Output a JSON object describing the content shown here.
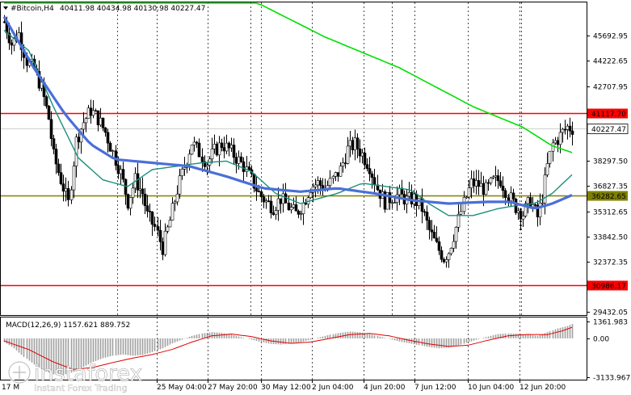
{
  "header": {
    "symbol_label": "#Bitcoin,H4",
    "ohlc": "40411.98 40434.98 40130.98 40227.47"
  },
  "chart_data": [
    {
      "type": "candlestick",
      "symbol": "#Bitcoin",
      "timeframe": "H4",
      "ylim": [
        29432.05,
        47162.61
      ],
      "y_ticks": [
        "45692.95",
        "44222.65",
        "42707.95",
        "38297.50",
        "36827.35",
        "35312.65",
        "33842.50",
        "32372.35",
        "29432.05"
      ],
      "x_ticks": [
        "17 M",
        "25 May 04:00",
        "27 May 20:00",
        "30 May 12:00",
        "2 Jun 04:00",
        "4 Jun 20:00",
        "7 Jun 12:00",
        "10 Jun 04:00",
        "12 Jun 20:00"
      ],
      "last_price": "40227.47",
      "levels": [
        {
          "value": 41117.7,
          "label": "41117.70",
          "color": "#ff0000"
        },
        {
          "value": 36282.65,
          "label": "36282.65",
          "color": "#808000"
        },
        {
          "value": 30986.17,
          "label": "30986.17",
          "color": "#ff0000"
        }
      ],
      "price_path": [
        [
          0,
          46500
        ],
        [
          3,
          45200
        ],
        [
          6,
          45800
        ],
        [
          9,
          44200
        ],
        [
          12,
          43700
        ],
        [
          15,
          42600
        ],
        [
          18,
          40800
        ],
        [
          20,
          38600
        ],
        [
          23,
          37200
        ],
        [
          26,
          35800
        ],
        [
          29,
          39500
        ],
        [
          32,
          40600
        ],
        [
          35,
          41300
        ],
        [
          38,
          40800
        ],
        [
          41,
          40000
        ],
        [
          44,
          38800
        ],
        [
          47,
          37600
        ],
        [
          50,
          35900
        ],
        [
          53,
          37200
        ],
        [
          56,
          36400
        ],
        [
          58,
          35100
        ],
        [
          61,
          34400
        ],
        [
          64,
          33200
        ],
        [
          67,
          34800
        ],
        [
          70,
          36600
        ],
        [
          73,
          38000
        ],
        [
          76,
          39400
        ],
        [
          79,
          38800
        ],
        [
          82,
          38200
        ],
        [
          85,
          38900
        ],
        [
          88,
          39300
        ],
        [
          91,
          39000
        ],
        [
          94,
          38500
        ],
        [
          97,
          38000
        ],
        [
          100,
          37200
        ],
        [
          103,
          36400
        ],
        [
          106,
          35900
        ],
        [
          109,
          35600
        ],
        [
          112,
          36100
        ],
        [
          115,
          35600
        ],
        [
          118,
          35200
        ],
        [
          121,
          35800
        ],
        [
          124,
          36800
        ],
        [
          127,
          37000
        ],
        [
          130,
          36700
        ],
        [
          133,
          37200
        ],
        [
          136,
          37800
        ],
        [
          139,
          39000
        ],
        [
          142,
          39300
        ],
        [
          145,
          38700
        ],
        [
          148,
          38000
        ],
        [
          151,
          36700
        ],
        [
          154,
          35900
        ],
        [
          157,
          36200
        ],
        [
          160,
          36300
        ],
        [
          163,
          36000
        ],
        [
          166,
          36100
        ],
        [
          169,
          35500
        ],
        [
          172,
          34200
        ],
        [
          175,
          33300
        ],
        [
          178,
          32600
        ],
        [
          180,
          33000
        ],
        [
          183,
          34400
        ],
        [
          186,
          35800
        ],
        [
          189,
          37000
        ],
        [
          192,
          36900
        ],
        [
          195,
          36600
        ],
        [
          198,
          37100
        ],
        [
          201,
          37200
        ],
        [
          204,
          36300
        ],
        [
          207,
          35600
        ],
        [
          210,
          35200
        ],
        [
          213,
          36000
        ],
        [
          216,
          35000
        ],
        [
          218,
          36200
        ],
        [
          220,
          38000
        ],
        [
          222,
          39300
        ],
        [
          224,
          39600
        ],
        [
          226,
          40000
        ],
        [
          228,
          40300
        ],
        [
          230,
          40227
        ]
      ],
      "ma_slow": [
        [
          0,
          52000
        ],
        [
          60,
          50000
        ],
        [
          100,
          47800
        ],
        [
          130,
          45600
        ],
        [
          160,
          43800
        ],
        [
          190,
          41500
        ],
        [
          210,
          40300
        ],
        [
          222,
          39200
        ],
        [
          230,
          38800
        ]
      ],
      "ma_mid": [
        [
          0,
          46800
        ],
        [
          12,
          43800
        ],
        [
          25,
          41000
        ],
        [
          35,
          39300
        ],
        [
          45,
          38400
        ],
        [
          60,
          38200
        ],
        [
          75,
          38000
        ],
        [
          90,
          37400
        ],
        [
          105,
          36700
        ],
        [
          120,
          36500
        ],
        [
          135,
          36700
        ],
        [
          150,
          36400
        ],
        [
          165,
          36000
        ],
        [
          180,
          35800
        ],
        [
          195,
          35900
        ],
        [
          205,
          35900
        ],
        [
          215,
          35500
        ],
        [
          222,
          35800
        ],
        [
          230,
          36300
        ]
      ],
      "ma_fast": [
        [
          0,
          46000
        ],
        [
          10,
          44800
        ],
        [
          20,
          41500
        ],
        [
          30,
          38500
        ],
        [
          40,
          37200
        ],
        [
          50,
          36800
        ],
        [
          60,
          37800
        ],
        [
          70,
          38000
        ],
        [
          80,
          38200
        ],
        [
          90,
          38300
        ],
        [
          100,
          37700
        ],
        [
          110,
          36400
        ],
        [
          120,
          35800
        ],
        [
          135,
          36400
        ],
        [
          145,
          37000
        ],
        [
          155,
          36800
        ],
        [
          165,
          36600
        ],
        [
          172,
          35800
        ],
        [
          180,
          35100
        ],
        [
          190,
          35100
        ],
        [
          200,
          35500
        ],
        [
          208,
          35700
        ],
        [
          215,
          35800
        ],
        [
          222,
          36400
        ],
        [
          230,
          37500
        ]
      ]
    },
    {
      "type": "bar",
      "indicator": "MACD",
      "params_label": "MACD(12,26,9) 1157.621 889.752",
      "ylim": [
        -3133.967,
        1361.983
      ],
      "y_ticks": [
        "1361.983",
        "0.00",
        "-3133.967"
      ],
      "histogram": [
        [
          0,
          -300
        ],
        [
          4,
          -800
        ],
        [
          8,
          -1500
        ],
        [
          12,
          -2100
        ],
        [
          16,
          -2600
        ],
        [
          20,
          -2900
        ],
        [
          24,
          -2950
        ],
        [
          28,
          -2700
        ],
        [
          32,
          -2300
        ],
        [
          36,
          -1900
        ],
        [
          40,
          -1600
        ],
        [
          44,
          -1400
        ],
        [
          48,
          -1300
        ],
        [
          52,
          -1400
        ],
        [
          56,
          -1350
        ],
        [
          60,
          -1100
        ],
        [
          64,
          -800
        ],
        [
          68,
          -400
        ],
        [
          72,
          -100
        ],
        [
          76,
          200
        ],
        [
          80,
          400
        ],
        [
          84,
          500
        ],
        [
          88,
          450
        ],
        [
          92,
          300
        ],
        [
          96,
          100
        ],
        [
          100,
          -100
        ],
        [
          104,
          -300
        ],
        [
          108,
          -450
        ],
        [
          112,
          -500
        ],
        [
          116,
          -400
        ],
        [
          120,
          -300
        ],
        [
          124,
          -100
        ],
        [
          128,
          100
        ],
        [
          132,
          300
        ],
        [
          136,
          450
        ],
        [
          140,
          550
        ],
        [
          144,
          500
        ],
        [
          148,
          350
        ],
        [
          152,
          150
        ],
        [
          156,
          -50
        ],
        [
          160,
          -250
        ],
        [
          164,
          -400
        ],
        [
          168,
          -550
        ],
        [
          172,
          -700
        ],
        [
          176,
          -800
        ],
        [
          180,
          -750
        ],
        [
          184,
          -550
        ],
        [
          188,
          -300
        ],
        [
          192,
          -50
        ],
        [
          196,
          150
        ],
        [
          200,
          350
        ],
        [
          204,
          400
        ],
        [
          208,
          380
        ],
        [
          212,
          300
        ],
        [
          216,
          200
        ],
        [
          220,
          500
        ],
        [
          224,
          800
        ],
        [
          228,
          1000
        ],
        [
          230,
          1157
        ]
      ],
      "signal": [
        [
          0,
          -200
        ],
        [
          10,
          -900
        ],
        [
          20,
          -1900
        ],
        [
          28,
          -2500
        ],
        [
          36,
          -2350
        ],
        [
          44,
          -1950
        ],
        [
          52,
          -1600
        ],
        [
          60,
          -1300
        ],
        [
          68,
          -900
        ],
        [
          76,
          -300
        ],
        [
          84,
          200
        ],
        [
          92,
          350
        ],
        [
          100,
          150
        ],
        [
          108,
          -200
        ],
        [
          116,
          -400
        ],
        [
          124,
          -300
        ],
        [
          132,
          0
        ],
        [
          140,
          300
        ],
        [
          148,
          400
        ],
        [
          156,
          200
        ],
        [
          164,
          -150
        ],
        [
          172,
          -450
        ],
        [
          180,
          -650
        ],
        [
          188,
          -550
        ],
        [
          196,
          -150
        ],
        [
          204,
          200
        ],
        [
          212,
          320
        ],
        [
          220,
          300
        ],
        [
          226,
          600
        ],
        [
          230,
          890
        ]
      ]
    }
  ],
  "watermark": {
    "brand": "instaforex",
    "tagline": "Instant Forex Trading"
  }
}
